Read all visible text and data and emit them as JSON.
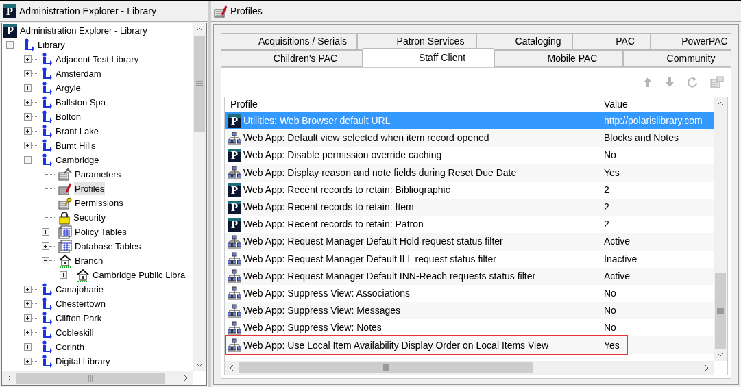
{
  "left_pane": {
    "title_logo": "P",
    "title": "Administration Explorer - Library",
    "tree": [
      {
        "label": "Administration Explorer - Library",
        "kind": "app",
        "logo": "P",
        "selected": false,
        "children": [
          {
            "label": "Library",
            "kind": "library",
            "expanded": true,
            "selected": false,
            "children": [
              {
                "label": "Adjacent Test Library",
                "kind": "library",
                "expanded": false,
                "selected": false
              },
              {
                "label": "Amsterdam",
                "kind": "library",
                "expanded": false,
                "selected": false
              },
              {
                "label": "Argyle",
                "kind": "library",
                "expanded": false,
                "selected": false
              },
              {
                "label": "Ballston Spa",
                "kind": "library",
                "expanded": false,
                "selected": false
              },
              {
                "label": "Bolton",
                "kind": "library",
                "expanded": false,
                "selected": false
              },
              {
                "label": "Brant Lake",
                "kind": "library",
                "expanded": false,
                "selected": false
              },
              {
                "label": "Bumt Hills",
                "kind": "library",
                "expanded": false,
                "selected": false
              },
              {
                "label": "Cambridge",
                "kind": "library",
                "expanded": true,
                "selected": false,
                "children": [
                  {
                    "label": "Parameters",
                    "kind": "parameters",
                    "selected": false
                  },
                  {
                    "label": "Profiles",
                    "kind": "profiles",
                    "selected": true
                  },
                  {
                    "label": "Permissions",
                    "kind": "permissions",
                    "selected": false
                  },
                  {
                    "label": "Security",
                    "kind": "security",
                    "selected": false
                  },
                  {
                    "label": "Policy Tables",
                    "kind": "table",
                    "expanded": false,
                    "selected": false
                  },
                  {
                    "label": "Database Tables",
                    "kind": "table",
                    "expanded": false,
                    "selected": false
                  },
                  {
                    "label": "Branch",
                    "kind": "branch",
                    "expanded": true,
                    "selected": false,
                    "children": [
                      {
                        "label": "Cambridge Public Libra",
                        "kind": "branch",
                        "expanded": false,
                        "selected": false
                      }
                    ]
                  }
                ]
              },
              {
                "label": "Canajoharie",
                "kind": "library",
                "expanded": false,
                "selected": false
              },
              {
                "label": "Chestertown",
                "kind": "library",
                "expanded": false,
                "selected": false
              },
              {
                "label": "Clifton Park",
                "kind": "library",
                "expanded": false,
                "selected": false
              },
              {
                "label": "Cobleskill",
                "kind": "library",
                "expanded": false,
                "selected": false
              },
              {
                "label": "Corinth",
                "kind": "library",
                "expanded": false,
                "selected": false
              },
              {
                "label": "Digital Library",
                "kind": "library",
                "expanded": false,
                "selected": false
              }
            ]
          }
        ]
      }
    ]
  },
  "right_pane": {
    "title": "Profiles",
    "tab_rows": [
      [
        {
          "label": "Acquisitions / Serials",
          "selected": false
        },
        {
          "label": "Patron Services",
          "selected": false
        },
        {
          "label": "Cataloging",
          "selected": false
        },
        {
          "label": "PAC",
          "selected": false
        },
        {
          "label": "PowerPAC",
          "selected": false
        }
      ],
      [
        {
          "label": "Children's PAC",
          "selected": false
        },
        {
          "label": "Staff Client",
          "selected": true
        },
        {
          "label": "Mobile PAC",
          "selected": false
        },
        {
          "label": "Community",
          "selected": false
        }
      ]
    ],
    "table": {
      "columns": [
        "Profile",
        "Value"
      ],
      "rows": [
        {
          "kind": "polaris",
          "logo": "P",
          "profile": "Utilities: Web Browser default URL",
          "value": "http://polarislibrary.com",
          "selected": true,
          "outlined": false
        },
        {
          "kind": "network",
          "profile": "Web App: Default view selected when item record opened",
          "value": "Blocks and Notes",
          "selected": false,
          "outlined": false
        },
        {
          "kind": "polaris",
          "logo": "P",
          "profile": "Web App: Disable permission override caching",
          "value": "No",
          "selected": false,
          "outlined": false
        },
        {
          "kind": "network",
          "profile": "Web App: Display reason and note fields during Reset Due Date",
          "value": "Yes",
          "selected": false,
          "outlined": false
        },
        {
          "kind": "polaris",
          "logo": "P",
          "profile": "Web App: Recent records to retain: Bibliographic",
          "value": "2",
          "selected": false,
          "outlined": false
        },
        {
          "kind": "polaris",
          "logo": "P",
          "profile": "Web App: Recent records to retain: Item",
          "value": "2",
          "selected": false,
          "outlined": false
        },
        {
          "kind": "polaris",
          "logo": "P",
          "profile": "Web App: Recent records to retain: Patron",
          "value": "2",
          "selected": false,
          "outlined": false
        },
        {
          "kind": "network",
          "profile": "Web App: Request Manager Default Hold request status filter",
          "value": "Active",
          "selected": false,
          "outlined": false
        },
        {
          "kind": "network",
          "profile": "Web App: Request Manager Default ILL request status filter",
          "value": "Inactive",
          "selected": false,
          "outlined": false
        },
        {
          "kind": "network",
          "profile": "Web App: Request Manager Default INN-Reach requests status filter",
          "value": "Active",
          "selected": false,
          "outlined": false
        },
        {
          "kind": "network",
          "profile": "Web App: Suppress View: Associations",
          "value": "No",
          "selected": false,
          "outlined": false
        },
        {
          "kind": "network",
          "profile": "Web App: Suppress View: Messages",
          "value": "No",
          "selected": false,
          "outlined": false
        },
        {
          "kind": "network",
          "profile": "Web App: Suppress View: Notes",
          "value": "No",
          "selected": false,
          "outlined": false
        },
        {
          "kind": "network",
          "profile": "Web App: Use Local Item Availability Display Order on Local Items View",
          "value": "Yes",
          "selected": false,
          "outlined": true
        }
      ]
    }
  }
}
